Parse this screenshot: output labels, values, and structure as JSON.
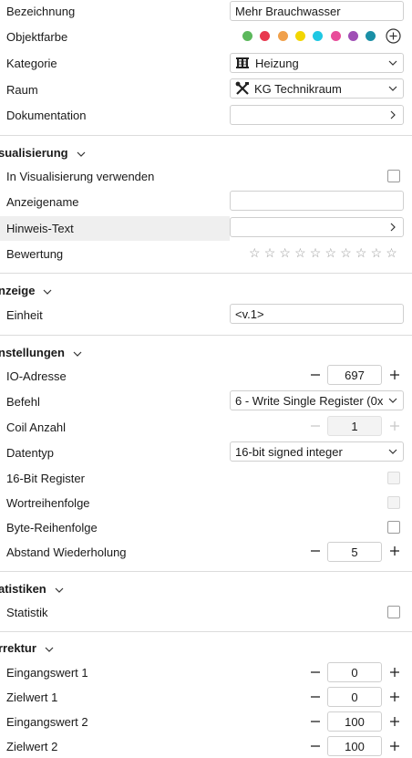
{
  "general": {
    "bezeichnung_label": "Bezeichnung",
    "bezeichnung_value": "Mehr Brauchwasser",
    "objektfarbe_label": "Objektfarbe",
    "colors": [
      "#5cb85c",
      "#e8384f",
      "#f0a04b",
      "#f2d600",
      "#1fc8e3",
      "#e84c9a",
      "#a04fb5",
      "#1a8fa6"
    ],
    "kategorie_label": "Kategorie",
    "kategorie_value": "Heizung",
    "kategorie_icon": "heater-icon",
    "raum_label": "Raum",
    "raum_value": "KG Technikraum",
    "raum_icon": "tools-icon",
    "dokumentation_label": "Dokumentation"
  },
  "visualisierung": {
    "title": "sualisierung",
    "in_visualisierung_label": "In Visualisierung verwenden",
    "anzeigename_label": "Anzeigename",
    "hinweis_label": "Hinweis-Text",
    "bewertung_label": "Bewertung",
    "stars_total": 10,
    "stars_filled": 0
  },
  "anzeige": {
    "title": "nzeige",
    "einheit_label": "Einheit",
    "einheit_value": "<v.1>"
  },
  "einstellungen": {
    "title": "nstellungen",
    "io_label": "IO-Adresse",
    "io_value": "697",
    "befehl_label": "Befehl",
    "befehl_value": "6 - Write Single Register (0x",
    "coil_label": "Coil Anzahl",
    "coil_value": "1",
    "datentyp_label": "Datentyp",
    "datentyp_value": "16-bit signed integer",
    "reg16_label": "16-Bit Register",
    "wortreihenfolge_label": "Wortreihenfolge",
    "bytereihenfolge_label": "Byte-Reihenfolge",
    "abstand_label": "Abstand Wiederholung",
    "abstand_value": "5"
  },
  "statistiken": {
    "title": "atistiken",
    "statistik_label": "Statistik"
  },
  "korrektur": {
    "title": "rrektur",
    "eingang1_label": "Eingangswert 1",
    "eingang1_value": "0",
    "ziel1_label": "Zielwert 1",
    "ziel1_value": "0",
    "eingang2_label": "Eingangswert 2",
    "eingang2_value": "100",
    "ziel2_label": "Zielwert 2",
    "ziel2_value": "100"
  }
}
